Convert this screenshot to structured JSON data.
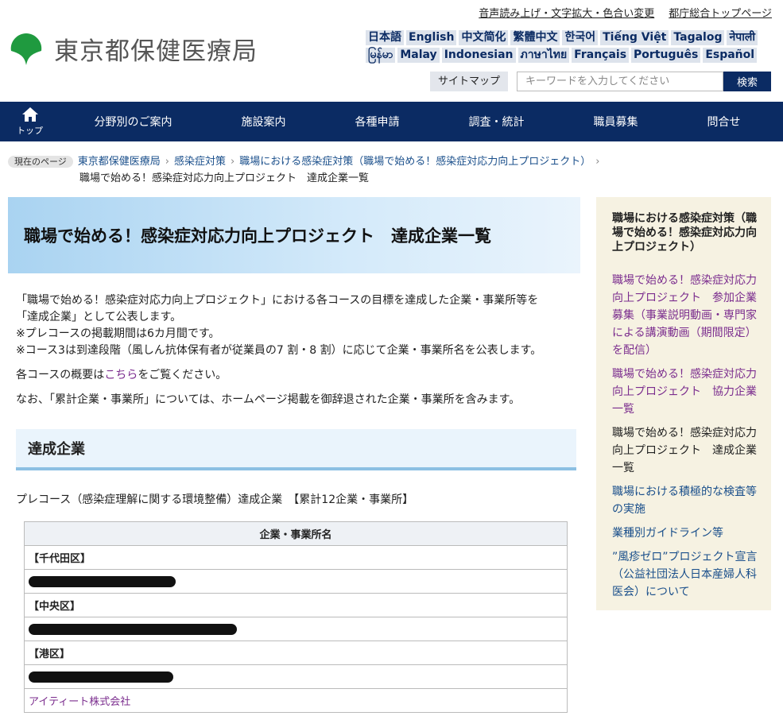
{
  "header": {
    "util_links": [
      "音声読み上げ・文字拡大・色合い変更",
      "都庁総合トップページ"
    ],
    "logo_text": "東京都保健医療局",
    "languages_row1": [
      "日本語",
      "English",
      "中文简化",
      "繁體中文",
      "한국어",
      "Tiếng Việt",
      "Tagalog",
      "नेपाली"
    ],
    "languages_row2": [
      "မြန်မာ",
      "Malay",
      "Indonesian",
      "ภาษาไทย",
      "Français",
      "Português",
      "Español"
    ],
    "sitemap_label": "サイトマップ",
    "search_placeholder": "キーワードを入力してください",
    "search_button": "検索"
  },
  "nav": {
    "home_label": "トップ",
    "items": [
      "分野別のご案内",
      "施設案内",
      "各種申請",
      "調査・統計",
      "職員募集",
      "問合せ"
    ]
  },
  "breadcrumb": {
    "tag": "現在のページ",
    "links": [
      "東京都保健医療局",
      "感染症対策",
      "職場における感染症対策（職場で始める！感染症対応力向上プロジェクト）"
    ],
    "current": "職場で始める！感染症対応力向上プロジェクト　達成企業一覧"
  },
  "main": {
    "title": "職場で始める！感染症対応力向上プロジェクト　達成企業一覧",
    "intro_1a": "「職場で始める！感染症対応力向上プロジェクト」における各コースの目標を達成した企業・事業所等を",
    "intro_1b": "「達成企業」として公表します。",
    "intro_2": "※プレコースの掲載期間は6カ月間です。",
    "intro_3": "※コース3は到達段階（風しん抗体保有者が従業員の7 割・8 割）に応じて企業・事業所名を公表します。",
    "intro_4_pre": "各コースの概要は",
    "intro_4_link": "こちら",
    "intro_4_post": "をご覧ください。",
    "intro_5": "なお、「累計企業・事業所」については、ホームページ掲載を御辞退された企業・事業所を含みます。",
    "section_heading": "達成企業",
    "course_line": "プレコース（感染症理解に関する環境整備）達成企業　【累計12企業・事業所】",
    "table_header": "企業・事業所名",
    "wards": [
      "【千代田区】",
      "【中央区】",
      "【港区】"
    ],
    "company_visible": "アイティート株式会社"
  },
  "sidebar": {
    "heading": "職場における感染症対策（職場で始める！感染症対応力向上プロジェクト）",
    "items": [
      "職場で始める！感染症対応力向上プロジェクト　参加企業募集（事業説明動画・専門家による講演動画（期間限定）を配信）",
      "職場で始める！感染症対応力向上プロジェクト　協力企業一覧",
      "職場で始める！感染症対応力向上プロジェクト　達成企業一覧",
      "職場における積極的な検査等の実施",
      "業種別ガイドライン等",
      "”風疹ゼロ”プロジェクト宣言（公益社団法人日本産婦人科医会）について"
    ]
  },
  "colors": {
    "navy": "#0b2b63",
    "logo_green": "#1f9a3f",
    "visited_link": "#7b2d8e"
  }
}
